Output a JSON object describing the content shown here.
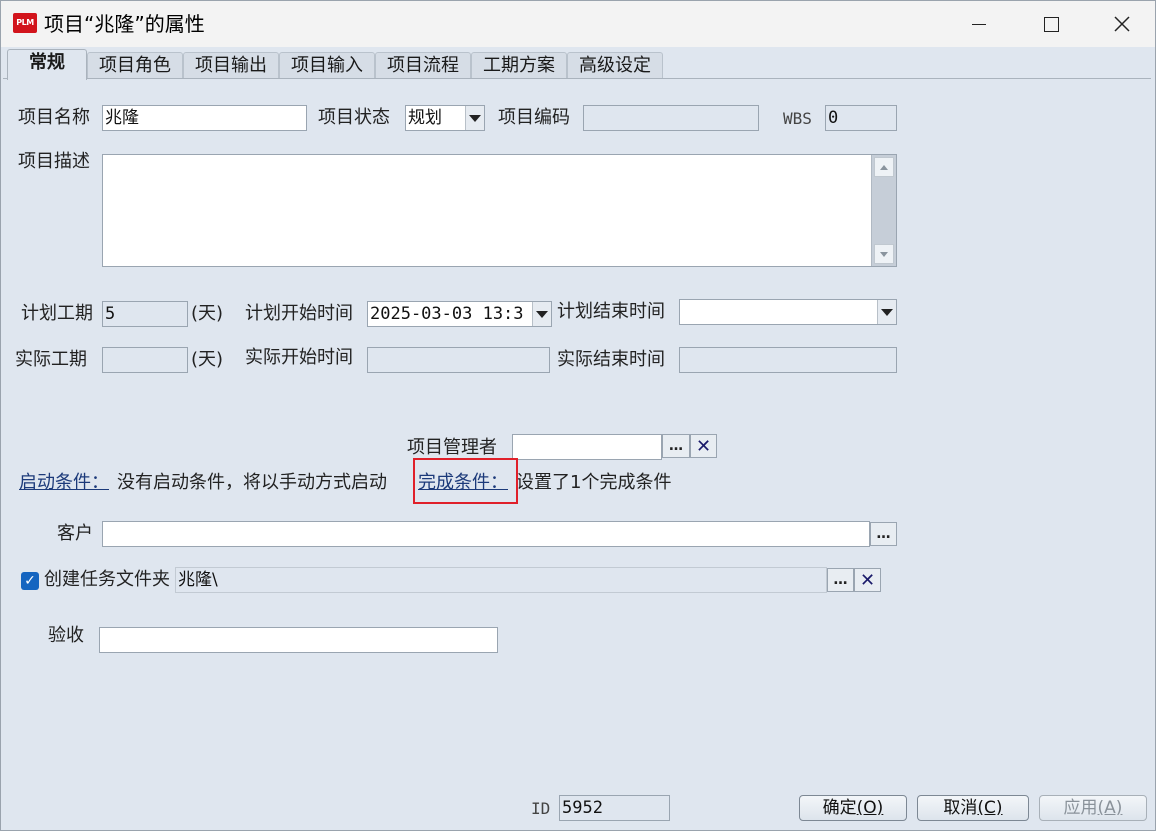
{
  "window": {
    "app_icon_text": "PLM",
    "title": "项目“兆隆”的属性"
  },
  "tabs": [
    {
      "label": "常规",
      "active": true
    },
    {
      "label": "项目角色"
    },
    {
      "label": "项目输出"
    },
    {
      "label": "项目输入"
    },
    {
      "label": "项目流程"
    },
    {
      "label": "工期方案"
    },
    {
      "label": "高级设定"
    }
  ],
  "general": {
    "project_name_label": "项目名称",
    "project_name_value": "兆隆",
    "project_status_label": "项目状态",
    "project_status_value": "规划",
    "project_code_label": "项目编码",
    "project_code_value": "",
    "wbs_label": "WBS",
    "wbs_value": "0",
    "description_label": "项目描述",
    "description_value": "",
    "planned_duration_label": "计划工期",
    "planned_duration_value": "5",
    "day_unit": "(天)",
    "planned_start_label": "计划开始时间",
    "planned_start_value": "2025-03-03 13:3",
    "planned_end_label": "计划结束时间",
    "planned_end_value": "",
    "actual_duration_label": "实际工期",
    "actual_duration_value": "",
    "actual_start_label": "实际开始时间",
    "actual_start_value": "",
    "actual_end_label": "实际结束时间",
    "actual_end_value": "",
    "manager_label": "项目管理者",
    "manager_value": "",
    "start_condition_link": "启动条件：",
    "start_condition_text": "没有启动条件，将以手动方式启动",
    "finish_condition_link": "完成条件：",
    "finish_condition_text": "设置了1个完成条件",
    "customer_label": "客户",
    "customer_value": "",
    "create_folder_label": "创建任务文件夹",
    "create_folder_checked": true,
    "create_folder_value": "兆隆\\",
    "acceptance_label": "验收",
    "acceptance_value": "",
    "browse_label": "…",
    "clear_label": "✕"
  },
  "footer": {
    "id_label": "ID",
    "id_value": "5952",
    "ok_label": "确定",
    "ok_key": "(O)",
    "cancel_label": "取消",
    "cancel_key": "(C)",
    "apply_label": "应用",
    "apply_key": "(A)"
  },
  "colors": {
    "accent_red": "#e0202a",
    "link_blue": "#1c3a7a",
    "checkbox_blue": "#1565c0"
  }
}
